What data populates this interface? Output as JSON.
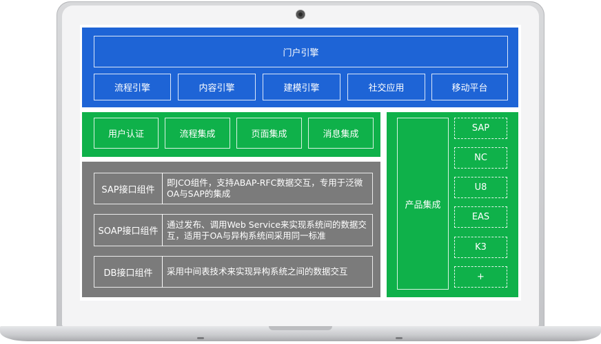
{
  "portal_engine": "门户引擎",
  "engines": [
    "流程引擎",
    "内容引擎",
    "建模引擎",
    "社交应用",
    "移动平台"
  ],
  "integrations": [
    "用户认证",
    "流程集成",
    "页面集成",
    "消息集成"
  ],
  "interfaces": [
    {
      "name": "SAP接口组件",
      "description": "即JCO组件，支持ABAP-RFC数据交互，专用于泛微OA与SAP的集成"
    },
    {
      "name": "SOAP接口组件",
      "description": "通过发布、调用Web Service来实现系统间的数据交互，适用于OA与异构系统间采用同一标准"
    },
    {
      "name": "DB接口组件",
      "description": "采用中间表技术来实现异构系统之间的数据交互"
    }
  ],
  "product_integration": {
    "title": "产品集成",
    "items": [
      "SAP",
      "NC",
      "U8",
      "EAS",
      "K3",
      "+"
    ]
  },
  "colors": {
    "blue": "#1e64d6",
    "green": "#0fb14a",
    "gray": "#7b7b7b"
  }
}
